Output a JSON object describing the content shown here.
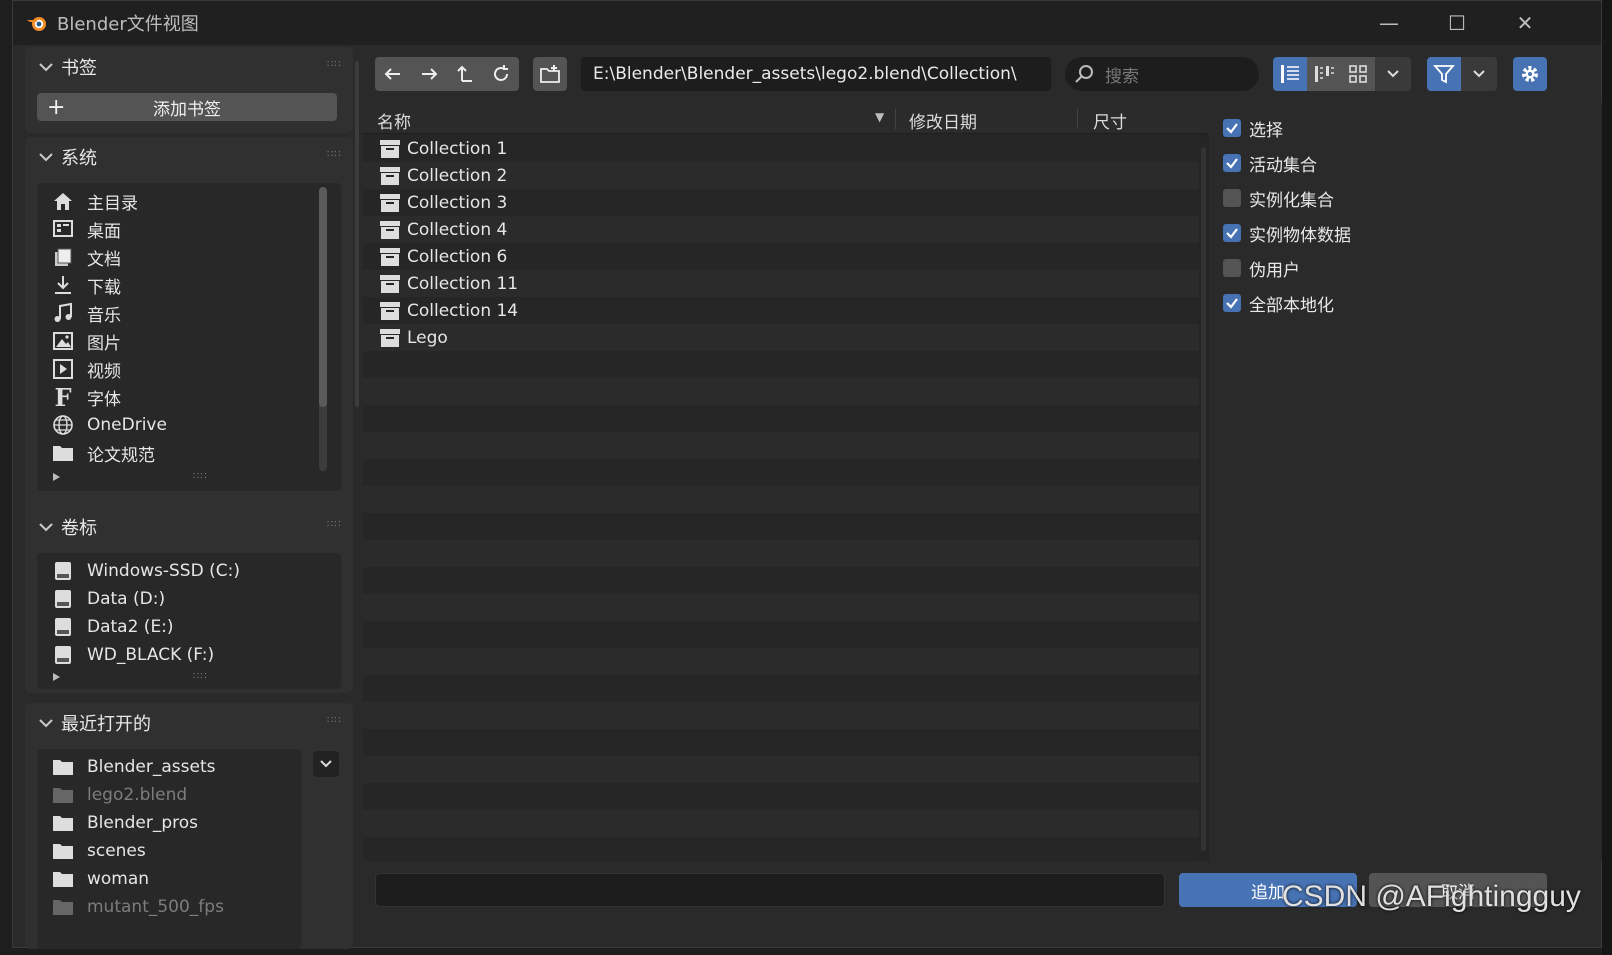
{
  "window": {
    "title": "Blender文件视图",
    "minimize": "—",
    "maximize": "☐",
    "close": "✕"
  },
  "bookmarks": {
    "title": "书签",
    "add_label": "添加书签"
  },
  "system": {
    "title": "系统",
    "items": [
      {
        "label": "主目录",
        "icon": "home-icon"
      },
      {
        "label": "桌面",
        "icon": "desktop-icon"
      },
      {
        "label": "文档",
        "icon": "documents-icon"
      },
      {
        "label": "下载",
        "icon": "download-icon"
      },
      {
        "label": "音乐",
        "icon": "music-icon"
      },
      {
        "label": "图片",
        "icon": "image-icon"
      },
      {
        "label": "视频",
        "icon": "video-icon"
      },
      {
        "label": "字体",
        "icon": "font-icon"
      },
      {
        "label": "OneDrive",
        "icon": "globe-icon"
      },
      {
        "label": "论文规范",
        "icon": "folder-icon"
      }
    ]
  },
  "volumes": {
    "title": "卷标",
    "items": [
      {
        "label": "Windows-SSD (C:)"
      },
      {
        "label": "Data (D:)"
      },
      {
        "label": "Data2 (E:)"
      },
      {
        "label": "WD_BLACK (F:)"
      }
    ]
  },
  "recent": {
    "title": "最近打开的",
    "items": [
      {
        "label": "Blender_assets",
        "dim": false
      },
      {
        "label": "lego2.blend",
        "dim": true
      },
      {
        "label": "Blender_pros",
        "dim": false
      },
      {
        "label": "scenes",
        "dim": false
      },
      {
        "label": "woman",
        "dim": false
      },
      {
        "label": "mutant_500_fps",
        "dim": true
      }
    ]
  },
  "toolbar": {
    "path": "E:\\Blender\\Blender_assets\\lego2.blend\\Collection\\",
    "search_placeholder": "搜索"
  },
  "columns": {
    "name": "名称",
    "date": "修改日期",
    "size": "尺寸"
  },
  "files": [
    {
      "name": "Collection 1"
    },
    {
      "name": "Collection 2"
    },
    {
      "name": "Collection 3"
    },
    {
      "name": "Collection 4"
    },
    {
      "name": "Collection 6"
    },
    {
      "name": "Collection 11"
    },
    {
      "name": "Collection 14"
    },
    {
      "name": "Lego"
    }
  ],
  "options": [
    {
      "label": "选择",
      "checked": true
    },
    {
      "label": "活动集合",
      "checked": true
    },
    {
      "label": "实例化集合",
      "checked": false
    },
    {
      "label": "实例物体数据",
      "checked": true
    },
    {
      "label": "伪用户",
      "checked": false
    },
    {
      "label": "全部本地化",
      "checked": true
    }
  ],
  "footer": {
    "filename": "",
    "confirm_label": "追加",
    "cancel_label": "取消"
  },
  "watermark": "CSDN @AFightingguy",
  "colors": {
    "accent": "#4772b3",
    "logo": "#f28c28"
  }
}
